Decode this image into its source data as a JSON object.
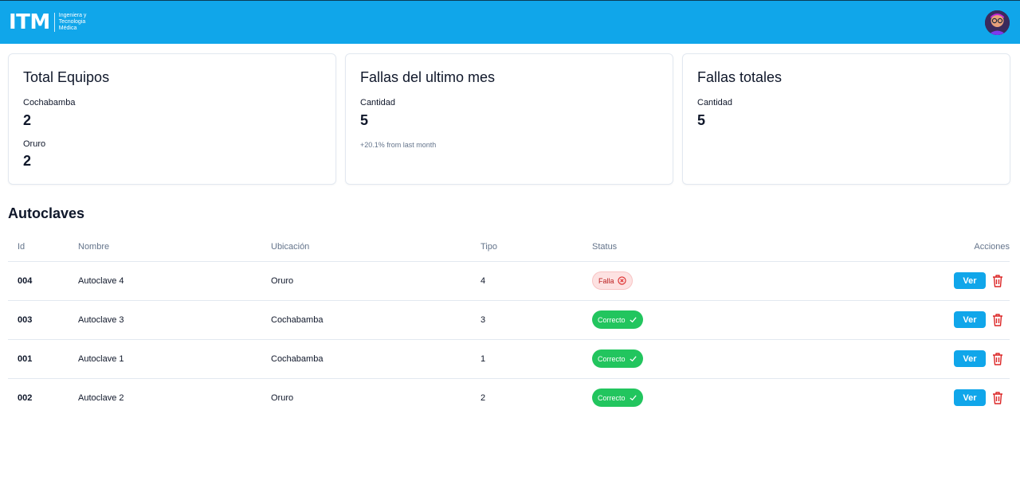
{
  "header": {
    "logo_text": "ITM",
    "logo_sub_line1": "Ingeniera y",
    "logo_sub_line2": "Tecnologia",
    "logo_sub_line3": "Médica"
  },
  "cards": {
    "total": {
      "title": "Total Equipos",
      "label1": "Cochabamba",
      "value1": "2",
      "label2": "Oruro",
      "value2": "2"
    },
    "month": {
      "title": "Fallas del ultimo mes",
      "label": "Cantidad",
      "value": "5",
      "note": "+20.1% from last month"
    },
    "totals": {
      "title": "Fallas totales",
      "label": "Cantidad",
      "value": "5"
    }
  },
  "table": {
    "title": "Autoclaves",
    "headers": {
      "id": "Id",
      "nombre": "Nombre",
      "ubicacion": "Ubicación",
      "tipo": "Tipo",
      "status": "Status",
      "acciones": "Acciones"
    },
    "rows": [
      {
        "id": "004",
        "nombre": "Autoclave 4",
        "ubicacion": "Oruro",
        "tipo": "4",
        "status": "Falla",
        "ver": "Ver"
      },
      {
        "id": "003",
        "nombre": "Autoclave 3",
        "ubicacion": "Cochabamba",
        "tipo": "3",
        "status": "Correcto",
        "ver": "Ver"
      },
      {
        "id": "001",
        "nombre": "Autoclave 1",
        "ubicacion": "Cochabamba",
        "tipo": "1",
        "status": "Correcto",
        "ver": "Ver"
      },
      {
        "id": "002",
        "nombre": "Autoclave 2",
        "ubicacion": "Oruro",
        "tipo": "2",
        "status": "Correcto",
        "ver": "Ver"
      }
    ]
  },
  "colors": {
    "brand": "#10a6ea",
    "success": "#22c55e",
    "danger": "#dc2626",
    "danger_bg": "#fde2e2"
  },
  "icons": {
    "status_falla": "x-circle-icon",
    "status_correcto": "check-icon",
    "delete": "trash-icon"
  }
}
